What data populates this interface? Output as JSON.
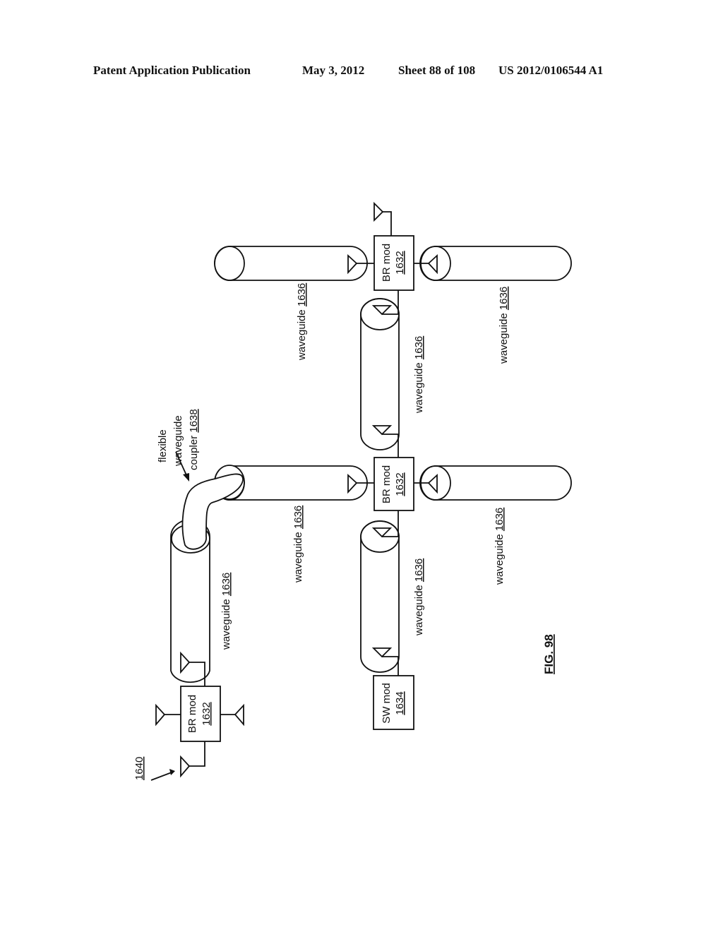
{
  "header": {
    "publication": "Patent Application Publication",
    "date": "May 3, 2012",
    "sheet": "Sheet 88 of 108",
    "number": "US 2012/0106544 A1"
  },
  "figure": {
    "label": "FIG. 98",
    "system_ref": "1640",
    "coupler": {
      "line1": "flexible",
      "line2": "waveguide",
      "line3": "coupler ",
      "ref": "1638"
    },
    "waveguide": {
      "word": "waveguide ",
      "ref": "1636"
    },
    "br_mod": {
      "word": "BR mod",
      "ref": "1632"
    },
    "sw_mod": {
      "word": "SW mod",
      "ref": "1634"
    }
  },
  "colors": {
    "ink": "#111111",
    "paper": "#ffffff"
  }
}
